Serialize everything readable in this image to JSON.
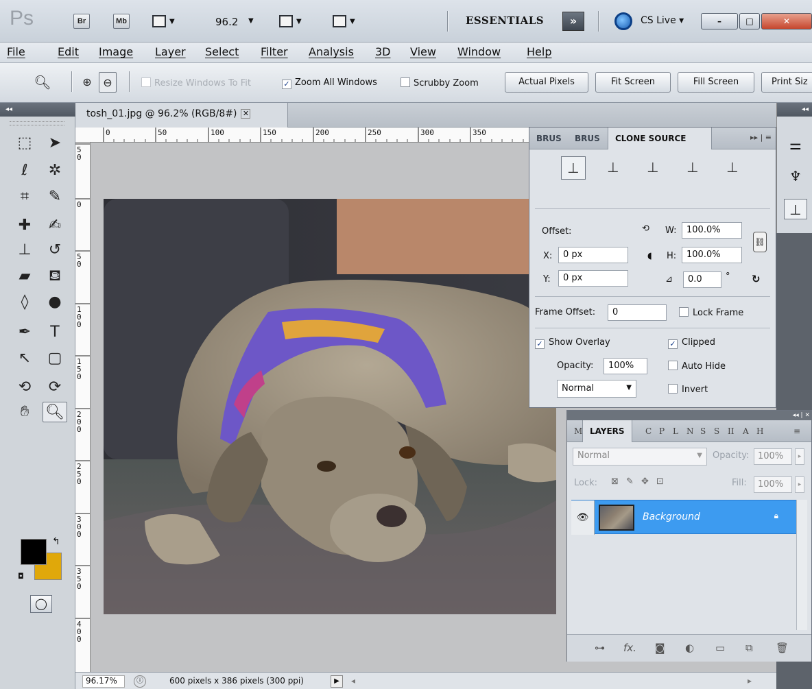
{
  "app": {
    "logo": "Ps",
    "bridge_label": "Br",
    "minibridge_label": "Mb",
    "zoom_level": "96.2",
    "workspace": "ESSENTIALS",
    "more_workspaces": "»",
    "cs_live": "CS Live ▾",
    "window_buttons": [
      "–",
      "□",
      "✕"
    ]
  },
  "menu": [
    "File",
    "Edit",
    "Image",
    "Layer",
    "Select",
    "Filter",
    "Analysis",
    "3D",
    "View",
    "Window",
    "Help"
  ],
  "options": {
    "resize_windows": "Resize Windows To Fit",
    "zoom_all_windows": "Zoom All Windows",
    "scrubby_zoom": "Scrubby Zoom",
    "actual_pixels": "Actual Pixels",
    "fit_screen": "Fit Screen",
    "fill_screen": "Fill Screen",
    "print_size": "Print Siz"
  },
  "document": {
    "tab_title": "tosh_01.jpg @ 96.2% (RGB/8#)",
    "ruler_top": [
      "0",
      "50",
      "100",
      "150",
      "200",
      "250",
      "300",
      "350"
    ],
    "ruler_left": [
      "5\n0",
      "0",
      "5\n0",
      "1\n0\n0",
      "1\n5\n0",
      "2\n0\n0",
      "2\n5\n0",
      "3\n0\n0",
      "3\n5\n0",
      "4\n0\n0"
    ],
    "status_zoom": "96.17%",
    "status_info": "600 pixels x 386 pixels (300 ppi)"
  },
  "clone_source": {
    "tabs": [
      "BRUS",
      "BRUS",
      "CLONE SOURCE"
    ],
    "offset_label": "Offset:",
    "x_label": "X:",
    "x_value": "0 px",
    "y_label": "Y:",
    "y_value": "0 px",
    "w_label": "W:",
    "w_value": "100.0%",
    "h_label": "H:",
    "h_value": "100.0%",
    "angle_value": "0.0",
    "degree": "°",
    "frame_offset_label": "Frame Offset:",
    "frame_offset_value": "0",
    "lock_frame": "Lock Frame",
    "show_overlay": "Show Overlay",
    "clipped": "Clipped",
    "opacity_label": "Opacity:",
    "opacity_value": "100%",
    "auto_hide": "Auto Hide",
    "mode": "Normal",
    "invert": "Invert"
  },
  "layers": {
    "tab_prefix": "M",
    "tab": "LAYERS",
    "other_tabs": [
      "C",
      "P",
      "L",
      "N",
      "S",
      "S",
      "II",
      "A",
      "H"
    ],
    "blend_mode": "Normal",
    "opacity_label": "Opacity:",
    "opacity_value": "100%",
    "lock_label": "Lock:",
    "fill_label": "Fill:",
    "fill_value": "100%",
    "layer_name": "Background",
    "footer_fx": "fx."
  }
}
